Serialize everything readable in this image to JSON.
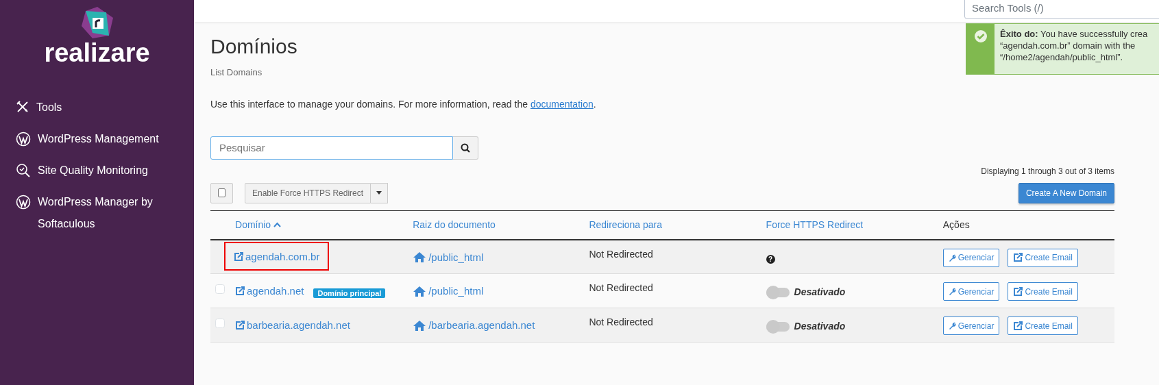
{
  "sidebar": {
    "logo_text": "realizare",
    "items": [
      {
        "label": "Tools"
      },
      {
        "label": "WordPress Management"
      },
      {
        "label": "Site Quality Monitoring"
      },
      {
        "label": "WordPress Manager by Softaculous"
      }
    ]
  },
  "topbar": {
    "search": {
      "placeholder": "Search Tools (/)"
    }
  },
  "alert": {
    "kind": "success",
    "lines": [
      "**Êxito do:** You have successfully crea",
      "“agendah.com.br” domain with the",
      "“/home2/agendah/public_html”."
    ]
  },
  "page": {
    "title": "Domínios",
    "subtitle": "List Domains",
    "intro": "Use this interface to manage your domains. For more information, read the",
    "intro_link": "documentation",
    "intro_end": "."
  },
  "search": {
    "placeholder": "Pesquisar"
  },
  "paging": "Displaying 1 through 3 out of 3 items",
  "bulk": {
    "checked": false,
    "action": "Enable Force HTTPS Redirect"
  },
  "create_button": "Create A New Domain",
  "table": {
    "columns": [
      {
        "label": "Domínio",
        "sorted": true,
        "sortable": true
      },
      {
        "label": "Raiz do documento",
        "sorted": false,
        "sortable": true
      },
      {
        "label": "Redireciona para",
        "sorted": false,
        "sortable": true
      },
      {
        "label": "Force HTTPS Redirect",
        "sorted": false,
        "sortable": true
      },
      {
        "label": "Ações",
        "sorted": false,
        "sortable": false
      }
    ],
    "rows": [
      {
        "selectable": false,
        "highlighted": true,
        "domain": "agendah.com.br",
        "badge": null,
        "root": "/public_html",
        "redirect": "Not Redirected",
        "https": {
          "kind": "unknown",
          "symbol": "?"
        },
        "actions": [
          "Gerenciar",
          "Create Email"
        ]
      },
      {
        "selectable": true,
        "checked": false,
        "highlighted": false,
        "domain": "agendah.net",
        "badge": "Domínio principal",
        "root": "/public_html",
        "redirect": "Not Redirected",
        "https": {
          "kind": "toggle",
          "on": false,
          "label": "Desativado"
        },
        "actions": [
          "Gerenciar",
          "Create Email"
        ]
      },
      {
        "selectable": true,
        "checked": false,
        "highlighted": false,
        "domain": "barbearia.agendah.net",
        "badge": null,
        "root": "/barbearia.agendah.net",
        "redirect": "Not Redirected",
        "https": {
          "kind": "toggle",
          "on": false,
          "label": "Desativado"
        },
        "actions": [
          "Gerenciar",
          "Create Email"
        ]
      }
    ]
  }
}
